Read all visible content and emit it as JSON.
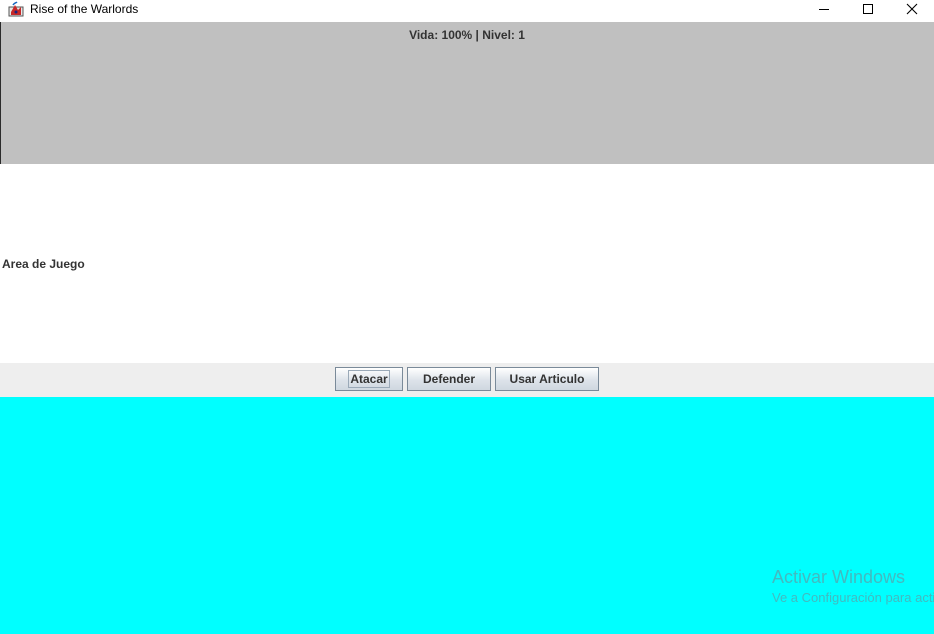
{
  "window": {
    "title": "Rise of the Warlords",
    "icon": "java-app-icon",
    "controls": [
      "minimize-icon",
      "maximize-icon",
      "close-icon"
    ]
  },
  "status_panel": {
    "text": "Vida: 100% | Nivel: 1",
    "background": "#c0c0c0"
  },
  "game_area": {
    "label": "Area de Juego",
    "background": "#ffffff"
  },
  "actions": {
    "attack_label": "Atacar",
    "defend_label": "Defender",
    "use_item_label": "Usar Articulo",
    "background": "#eeeeee"
  },
  "bottom_panel": {
    "background": "#00ffff"
  },
  "watermark": {
    "title": "Activar Windows",
    "subtitle": "Ve a Configuración para activar Windows."
  }
}
